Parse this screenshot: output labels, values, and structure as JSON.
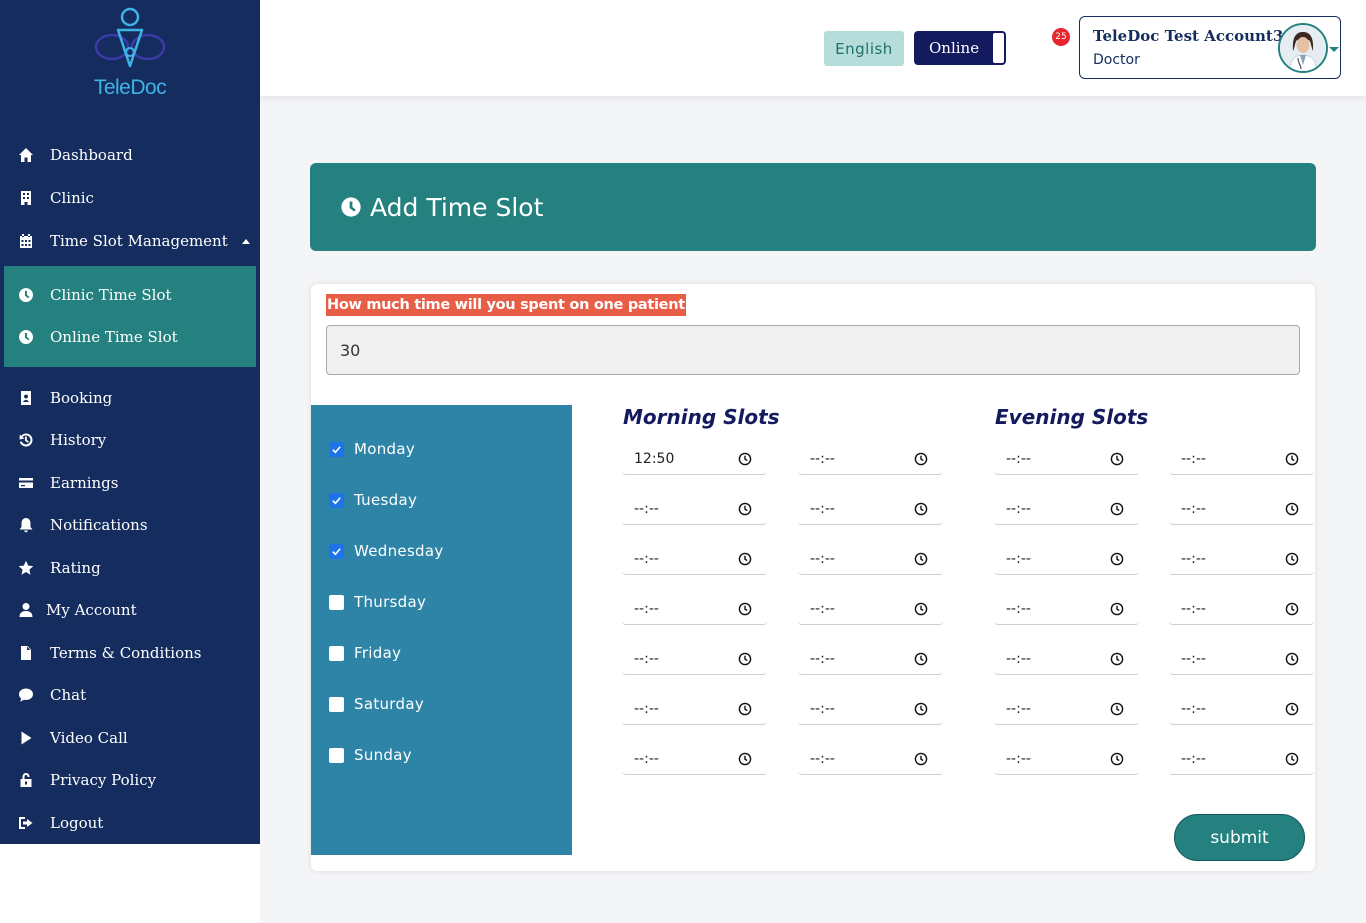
{
  "brand": {
    "logo_text": "TeleDoc"
  },
  "sidebar": {
    "items": [
      {
        "label": "Dashboard",
        "icon": "home-icon"
      },
      {
        "label": "Clinic",
        "icon": "building-icon"
      },
      {
        "label": "Time Slot Management",
        "icon": "calendar-icon"
      },
      {
        "label": "Clinic Time Slot",
        "icon": "clock-icon"
      },
      {
        "label": "Online Time Slot",
        "icon": "clock-icon"
      },
      {
        "label": "Booking",
        "icon": "contact-book-icon"
      },
      {
        "label": "History",
        "icon": "history-icon"
      },
      {
        "label": "Earnings",
        "icon": "credit-card-icon"
      },
      {
        "label": "Notifications",
        "icon": "bell-icon"
      },
      {
        "label": "Rating",
        "icon": "star-icon"
      },
      {
        "label": "My Account",
        "icon": "user-icon"
      },
      {
        "label": "Terms & Conditions",
        "icon": "file-icon"
      },
      {
        "label": "Chat",
        "icon": "chat-bubble-icon"
      },
      {
        "label": "Video Call",
        "icon": "play-icon"
      },
      {
        "label": "Privacy Policy",
        "icon": "unlock-icon"
      },
      {
        "label": "Logout",
        "icon": "sign-out-icon"
      }
    ]
  },
  "header": {
    "language": "English",
    "status": "Online",
    "notification_count": "25",
    "profile": {
      "name": "TeleDoc Test Account3",
      "role": "Doctor"
    }
  },
  "page": {
    "title": "Add Time Slot",
    "question": "How much time will you spent on one patient",
    "minutes_value": "30",
    "morning_heading": "Morning Slots",
    "evening_heading": "Evening Slots",
    "submit_label": "submit"
  },
  "days": [
    {
      "label": "Monday",
      "checked": true
    },
    {
      "label": "Tuesday",
      "checked": true
    },
    {
      "label": "Wednesday",
      "checked": true
    },
    {
      "label": "Thursday",
      "checked": false
    },
    {
      "label": "Friday",
      "checked": false
    },
    {
      "label": "Saturday",
      "checked": false
    },
    {
      "label": "Sunday",
      "checked": false
    }
  ],
  "slots": [
    [
      "12:50",
      "--:--",
      "--:--",
      "--:--"
    ],
    [
      "--:--",
      "--:--",
      "--:--",
      "--:--"
    ],
    [
      "--:--",
      "--:--",
      "--:--",
      "--:--"
    ],
    [
      "--:--",
      "--:--",
      "--:--",
      "--:--"
    ],
    [
      "--:--",
      "--:--",
      "--:--",
      "--:--"
    ],
    [
      "--:--",
      "--:--",
      "--:--",
      "--:--"
    ],
    [
      "--:--",
      "--:--",
      "--:--",
      "--:--"
    ]
  ],
  "colors": {
    "sidebar": "#142d5e",
    "accent_teal": "#24817f",
    "days_panel": "#2d84a6",
    "question_highlight": "#e85d46",
    "heading_navy": "#141a5e",
    "badge_red": "#e8262f"
  }
}
